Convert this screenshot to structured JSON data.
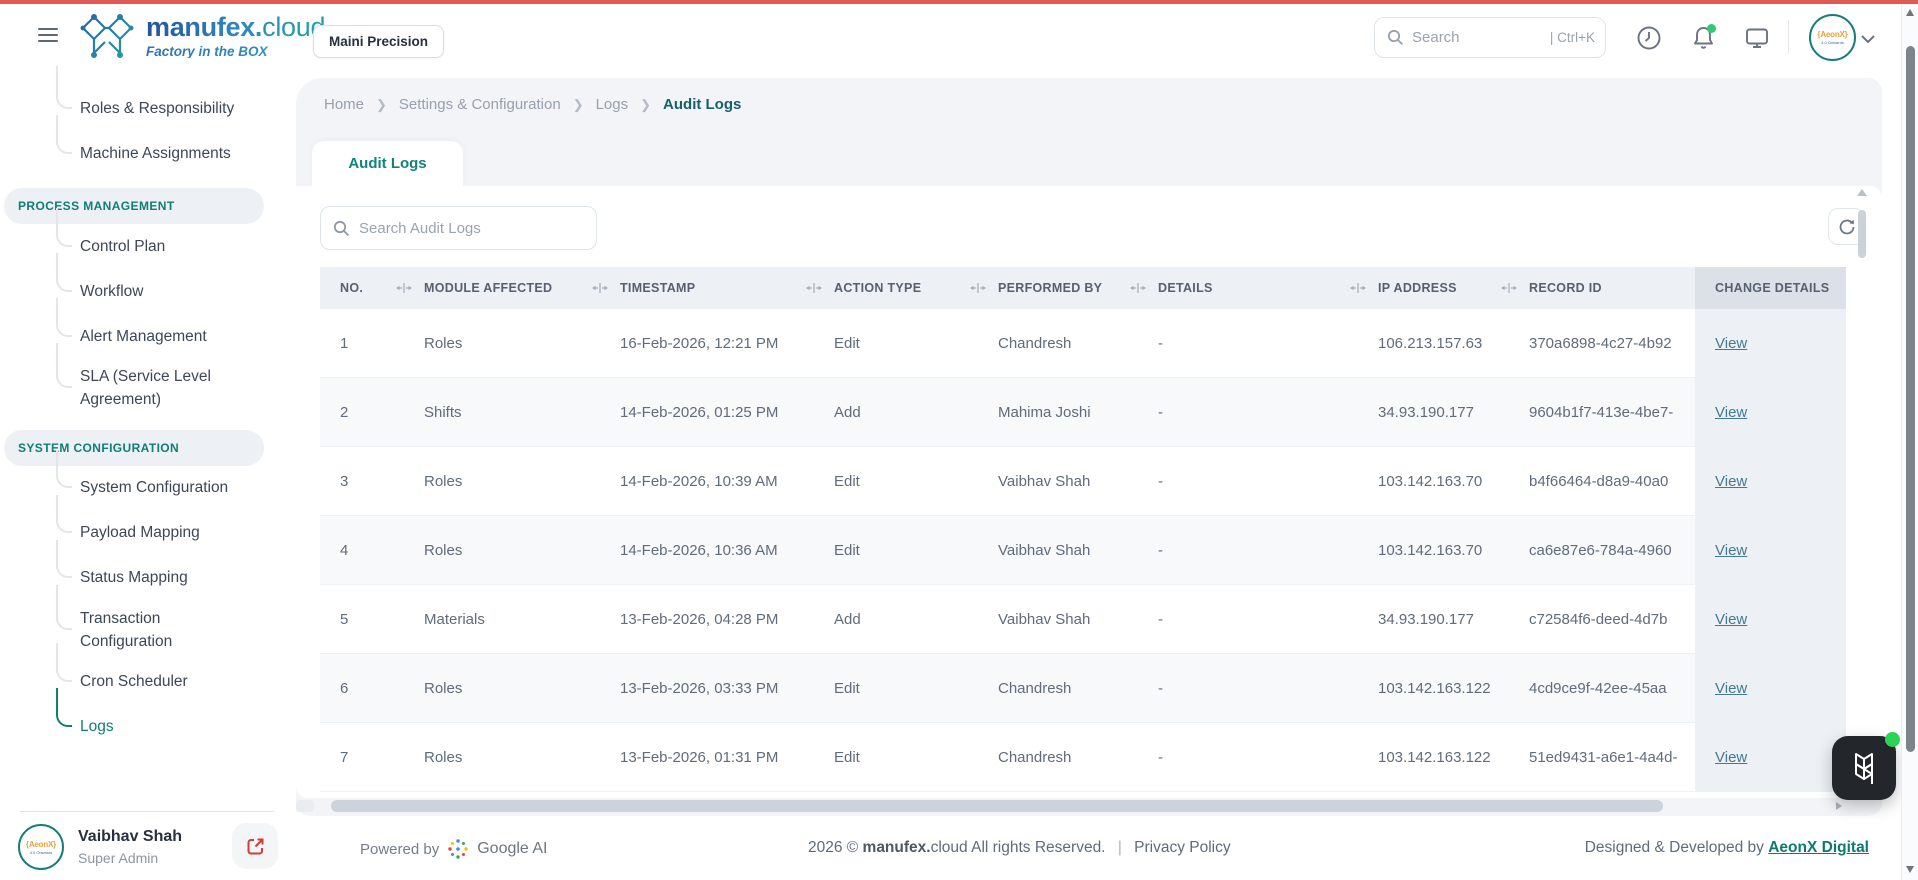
{
  "header": {
    "brand": {
      "name_bold": "manufex.",
      "name_light": "cloud",
      "tagline": "Factory in the BOX"
    },
    "org_chip": "Maini Precision",
    "search": {
      "placeholder": "Search",
      "shortcut": "| Ctrl+K"
    }
  },
  "sidebar": {
    "items": [
      {
        "type": "link",
        "label": "Roles & Responsibility"
      },
      {
        "type": "link",
        "label": "Machine Assignments"
      },
      {
        "type": "section",
        "label": "PROCESS MANAGEMENT"
      },
      {
        "type": "link",
        "label": "Control Plan"
      },
      {
        "type": "link",
        "label": "Workflow"
      },
      {
        "type": "link",
        "label": "Alert Management"
      },
      {
        "type": "link",
        "label": "SLA (Service Level Agreement)"
      },
      {
        "type": "section",
        "label": "SYSTEM CONFIGURATION"
      },
      {
        "type": "link",
        "label": "System Configuration"
      },
      {
        "type": "link",
        "label": "Payload Mapping"
      },
      {
        "type": "link",
        "label": "Status Mapping"
      },
      {
        "type": "link",
        "label": "Transaction Configuration"
      },
      {
        "type": "link",
        "label": "Cron Scheduler"
      },
      {
        "type": "link",
        "label": "Logs",
        "active": true
      }
    ],
    "profile": {
      "name": "Vaibhav Shah",
      "role": "Super Admin",
      "avatar_text": "{AeonX}",
      "avatar_sub": "4.0 Onwards"
    }
  },
  "breadcrumb": {
    "items": [
      "Home",
      "Settings & Configuration",
      "Logs"
    ],
    "current": "Audit Logs"
  },
  "tab_label": "Audit Logs",
  "toolbar": {
    "search_placeholder": "Search Audit Logs"
  },
  "table": {
    "columns": [
      {
        "key": "no",
        "label": "NO.",
        "resizable": true
      },
      {
        "key": "module",
        "label": "MODULE AFFECTED",
        "resizable": true
      },
      {
        "key": "timestamp",
        "label": "TIMESTAMP",
        "resizable": true
      },
      {
        "key": "action",
        "label": "ACTION TYPE",
        "resizable": true
      },
      {
        "key": "performed_by",
        "label": "PERFORMED BY",
        "resizable": true
      },
      {
        "key": "details",
        "label": "DETAILS",
        "resizable": true
      },
      {
        "key": "ip",
        "label": "IP ADDRESS",
        "resizable": true
      },
      {
        "key": "record_id",
        "label": "RECORD ID",
        "resizable": false
      },
      {
        "key": "change",
        "label": "CHANGE DETAILS",
        "resizable": false,
        "pinned": true
      }
    ],
    "rows": [
      {
        "no": "1",
        "module": "Roles",
        "timestamp": "16-Feb-2026, 12:21 PM",
        "action": "Edit",
        "performed_by": "Chandresh",
        "details": "-",
        "ip": "106.213.157.63",
        "record_id": "370a6898-4c27-4b92",
        "change": "View"
      },
      {
        "no": "2",
        "module": "Shifts",
        "timestamp": "14-Feb-2026, 01:25 PM",
        "action": "Add",
        "performed_by": "Mahima Joshi",
        "details": "-",
        "ip": "34.93.190.177",
        "record_id": "9604b1f7-413e-4be7-",
        "change": "View"
      },
      {
        "no": "3",
        "module": "Roles",
        "timestamp": "14-Feb-2026, 10:39 AM",
        "action": "Edit",
        "performed_by": "Vaibhav Shah",
        "details": "-",
        "ip": "103.142.163.70",
        "record_id": "b4f66464-d8a9-40a0",
        "change": "View"
      },
      {
        "no": "4",
        "module": "Roles",
        "timestamp": "14-Feb-2026, 10:36 AM",
        "action": "Edit",
        "performed_by": "Vaibhav Shah",
        "details": "-",
        "ip": "103.142.163.70",
        "record_id": "ca6e87e6-784a-4960",
        "change": "View"
      },
      {
        "no": "5",
        "module": "Materials",
        "timestamp": "13-Feb-2026, 04:28 PM",
        "action": "Add",
        "performed_by": "Vaibhav Shah",
        "details": "-",
        "ip": "34.93.190.177",
        "record_id": "c72584f6-deed-4d7b",
        "change": "View"
      },
      {
        "no": "6",
        "module": "Roles",
        "timestamp": "13-Feb-2026, 03:33 PM",
        "action": "Edit",
        "performed_by": "Chandresh",
        "details": "-",
        "ip": "103.142.163.122",
        "record_id": "4cd9ce9f-42ee-45aa",
        "change": "View"
      },
      {
        "no": "7",
        "module": "Roles",
        "timestamp": "13-Feb-2026, 01:31 PM",
        "action": "Edit",
        "performed_by": "Chandresh",
        "details": "-",
        "ip": "103.142.163.122",
        "record_id": "51ed9431-a6e1-4a4d-",
        "change": "View"
      }
    ]
  },
  "footer": {
    "powered_by": "Powered by",
    "google_ai": "Google AI",
    "copyright": {
      "prefix": "2026 ©",
      "brand_bold": "manufex.",
      "brand_light": "cloud",
      "rights": "All rights Reserved.",
      "privacy": "Privacy Policy"
    },
    "designed": {
      "prefix": "Designed & Developed by",
      "link": "AeonX Digital"
    }
  },
  "colors": {
    "accent_teal": "#0F7E73",
    "topbar_red": "#DF5A56",
    "view_link": "#44798E",
    "logout_red": "#D23B3B",
    "online_green": "#2EC971"
  }
}
